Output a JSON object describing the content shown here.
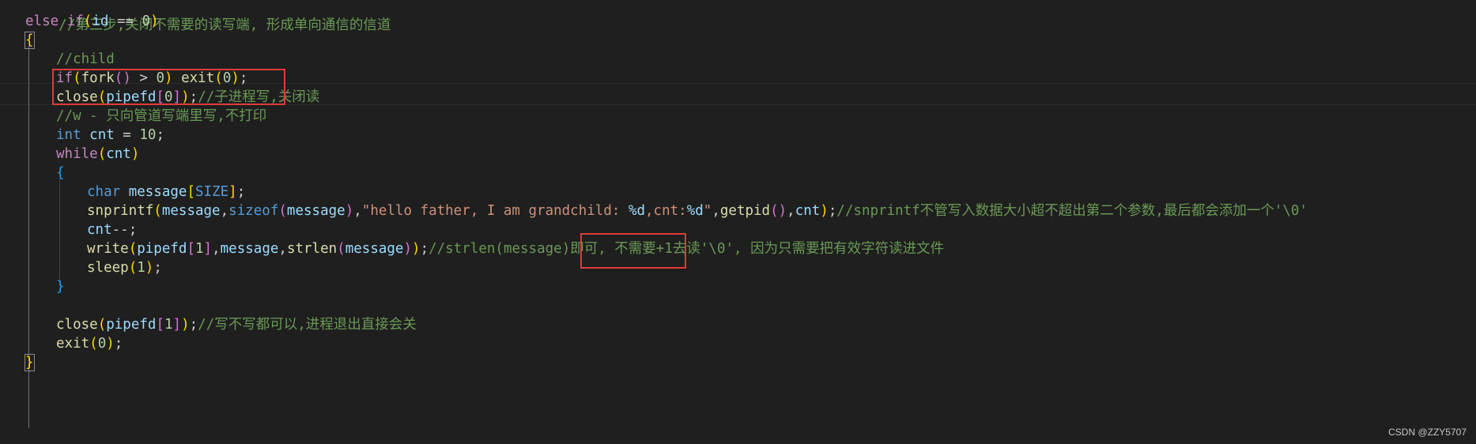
{
  "editor": {
    "lines": {
      "l0": "//第三步,关闭不需要的读写端, 形成单向通信的信道",
      "l1": {
        "else": "else",
        "if": "if",
        "id": "id",
        "op": " == ",
        "zero": "0"
      },
      "l2": "{",
      "l3": "//child",
      "l4": {
        "if": "if",
        "fork": "fork",
        "gt": " > ",
        "zero": "0",
        "exit": "exit",
        "arg": "0"
      },
      "l5": {
        "close": "close",
        "pipefd": "pipefd",
        "idx": "0",
        "comment": "//子进程写,关闭读"
      },
      "l6": "//w - 只向管道写端里写,不打印",
      "l7": {
        "type": "int",
        "name": "cnt",
        "eq": " = ",
        "val": "10"
      },
      "l8": {
        "while": "while",
        "cnt": "cnt"
      },
      "l9": "{",
      "l10": {
        "type": "char",
        "name": "message",
        "size": "SIZE"
      },
      "l11": {
        "fn": "snprintf",
        "arg1": "message",
        "sizeof": "sizeof",
        "arg2": "message",
        "str_a": "\"hello father, I am ",
        "str_b": "grandchild: ",
        "fmt1": "%d",
        "str_c": ",cnt:",
        "fmt2": "%d",
        "str_d": "\"",
        "getpid": "getpid",
        "cnt": "cnt",
        "comment": "//snprintf不管写入数据大小超不超出第二个参数,最后都会添加一个'\\0'"
      },
      "l12": {
        "cnt": "cnt",
        "op": "--"
      },
      "l13": {
        "write": "write",
        "pipefd": "pipefd",
        "idx": "1",
        "message": "message",
        "strlen": "strlen",
        "message2": "message",
        "comment": "//strlen(message)即可, 不需要+1去读'\\0', 因为只需要把有效字符读进文件"
      },
      "l14": {
        "sleep": "sleep",
        "arg": "1"
      },
      "l15": "}",
      "l16": "",
      "l17": {
        "close": "close",
        "pipefd": "pipefd",
        "idx": "1",
        "comment": "//写不写都可以,进程退出直接会关"
      },
      "l18": {
        "exit": "exit",
        "arg": "0"
      },
      "l19": "}"
    }
  },
  "watermark": "CSDN @ZZY5707",
  "colors": {
    "background": "#1f1f1f",
    "keyword": "#569cd6",
    "control": "#c586c0",
    "function": "#dcdcaa",
    "variable": "#9cdcfe",
    "number": "#b5cea8",
    "string": "#ce9178",
    "comment": "#6a9955",
    "annotation_box": "#e03a3a"
  }
}
